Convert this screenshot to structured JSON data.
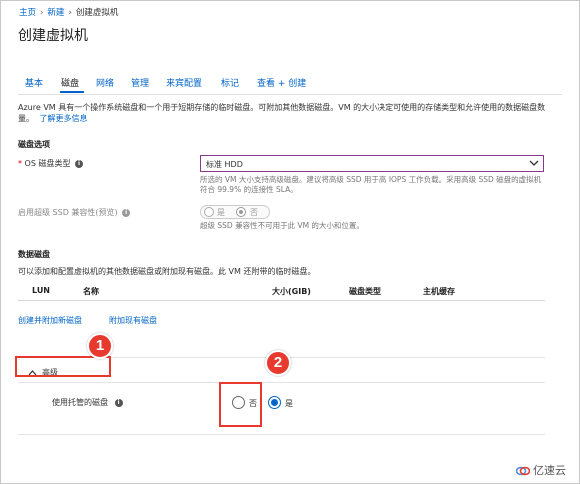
{
  "breadcrumb": {
    "home": "主页",
    "new": "新建",
    "current": "创建虚拟机"
  },
  "page": {
    "title": "创建虚拟机"
  },
  "tabs": [
    {
      "label": "基本"
    },
    {
      "label": "磁盘"
    },
    {
      "label": "网络"
    },
    {
      "label": "管理"
    },
    {
      "label": "来宾配置"
    },
    {
      "label": "标记"
    },
    {
      "label": "查看 + 创建"
    }
  ],
  "active_tab": "磁盘",
  "intro": {
    "text": "Azure VM 具有一个操作系统磁盘和一个用于短期存储的临时磁盘。可附加其他数据磁盘。VM 的大小决定可使用的存储类型和允许使用的数据磁盘数量。",
    "learn_more": "了解更多信息"
  },
  "disk_options": {
    "heading": "磁盘选项",
    "required_mark": "*",
    "os_disk_type_label": "OS 磁盘类型",
    "os_disk_type_value": "标准 HDD",
    "os_disk_hint": "所选的 VM 大小支持高级磁盘。建议将高级 SSD 用于高 IOPS 工作负载。采用高级 SSD 磁盘的虚拟机符合 99.9% 的连接性 SLA。",
    "ultra_ssd_label": "启用超级 SSD 兼容性(预览)",
    "ultra_yes": "是",
    "ultra_no": "否",
    "ultra_hint": "超级 SSD 兼容性不可用于此 VM 的大小和位置。"
  },
  "data_disks": {
    "heading": "数据磁盘",
    "description": "可以添加和配置虚拟机的其他数据磁盘或附加现有磁盘。此 VM 还附带的临时磁盘。",
    "columns": [
      "LUN",
      "名称",
      "大小(GIB)",
      "磁盘类型",
      "主机缓存"
    ],
    "create_attach": "创建并附加新磁盘",
    "attach_existing": "附加现有磁盘"
  },
  "advanced": {
    "toggle_label": "高级",
    "managed_disk_label": "使用托管的磁盘",
    "option_no": "否",
    "option_yes": "是",
    "selected": "是"
  },
  "annotations": {
    "badge1": "1",
    "badge2": "2"
  },
  "watermark": {
    "text": "亿速云"
  },
  "colors": {
    "link": "#0064c8",
    "annotation_red": "#e8392f",
    "select_border": "#8a3a8a"
  }
}
